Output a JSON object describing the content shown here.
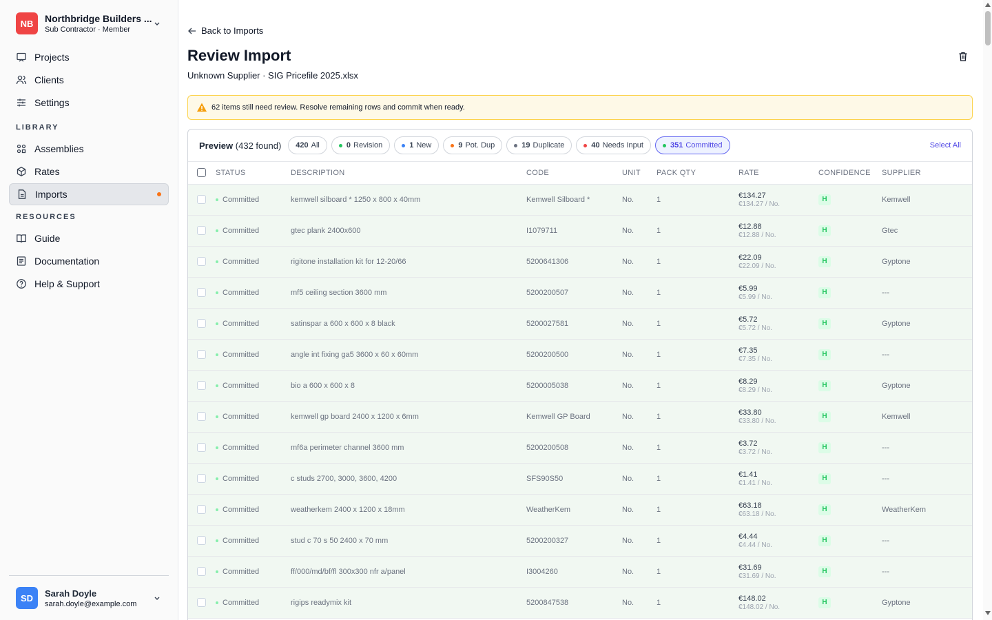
{
  "org": {
    "initials": "NB",
    "name": "Northbridge Builders ...",
    "role": "Sub Contractor · Member"
  },
  "nav": {
    "projects": "Projects",
    "clients": "Clients",
    "settings": "Settings",
    "library_heading": "LIBRARY",
    "assemblies": "Assemblies",
    "rates": "Rates",
    "imports": "Imports",
    "resources_heading": "RESOURCES",
    "guide": "Guide",
    "documentation": "Documentation",
    "help": "Help & Support"
  },
  "user": {
    "initials": "SD",
    "name": "Sarah Doyle",
    "email": "sarah.doyle@example.com"
  },
  "page": {
    "back": "Back to Imports",
    "title": "Review Import",
    "subtitle": "Unknown Supplier · SIG Pricefile 2025.xlsx",
    "alert": "62 items still need review. Resolve remaining rows and commit when ready."
  },
  "toolbar": {
    "preview_label": "Preview",
    "preview_count": "(432 found)",
    "select_all": "Select All",
    "chips": [
      {
        "count": "420",
        "label": "All",
        "color": ""
      },
      {
        "count": "0",
        "label": "Revision",
        "color": "#22c55e"
      },
      {
        "count": "1",
        "label": "New",
        "color": "#3b82f6"
      },
      {
        "count": "9",
        "label": "Pot. Dup",
        "color": "#f97316"
      },
      {
        "count": "19",
        "label": "Duplicate",
        "color": "#6b7280"
      },
      {
        "count": "40",
        "label": "Needs Input",
        "color": "#ef4444"
      },
      {
        "count": "351",
        "label": "Committed",
        "color": "#22c55e"
      }
    ]
  },
  "table": {
    "headers": [
      "STATUS",
      "DESCRIPTION",
      "CODE",
      "UNIT",
      "PACK QTY",
      "RATE",
      "CONFIDENCE",
      "SUPPLIER"
    ],
    "rows": [
      {
        "status": "Committed",
        "description": "kemwell silboard * 1250 x 800 x 40mm",
        "code": "Kemwell Silboard *",
        "unit": "No.",
        "pack": "1",
        "rate": "€134.27",
        "rate_unit": "€134.27 / No.",
        "conf": "H",
        "supplier": "Kemwell"
      },
      {
        "status": "Committed",
        "description": "gtec plank 2400x600",
        "code": "I1079711",
        "unit": "No.",
        "pack": "1",
        "rate": "€12.88",
        "rate_unit": "€12.88 / No.",
        "conf": "H",
        "supplier": "Gtec"
      },
      {
        "status": "Committed",
        "description": "rigitone installation kit for 12-20/66",
        "code": "5200641306",
        "unit": "No.",
        "pack": "1",
        "rate": "€22.09",
        "rate_unit": "€22.09 / No.",
        "conf": "H",
        "supplier": "Gyptone"
      },
      {
        "status": "Committed",
        "description": "mf5 ceiling section 3600 mm",
        "code": "5200200507",
        "unit": "No.",
        "pack": "1",
        "rate": "€5.99",
        "rate_unit": "€5.99 / No.",
        "conf": "H",
        "supplier": "---"
      },
      {
        "status": "Committed",
        "description": "satinspar a 600 x 600 x 8 black",
        "code": "5200027581",
        "unit": "No.",
        "pack": "1",
        "rate": "€5.72",
        "rate_unit": "€5.72 / No.",
        "conf": "H",
        "supplier": "Gyptone"
      },
      {
        "status": "Committed",
        "description": "angle int fixing ga5 3600 x 60 x 60mm",
        "code": "5200200500",
        "unit": "No.",
        "pack": "1",
        "rate": "€7.35",
        "rate_unit": "€7.35 / No.",
        "conf": "H",
        "supplier": "---"
      },
      {
        "status": "Committed",
        "description": "bio a 600 x 600 x 8",
        "code": "5200005038",
        "unit": "No.",
        "pack": "1",
        "rate": "€8.29",
        "rate_unit": "€8.29 / No.",
        "conf": "H",
        "supplier": "Gyptone"
      },
      {
        "status": "Committed",
        "description": "kemwell gp board 2400 x 1200 x 6mm",
        "code": "Kemwell GP Board",
        "unit": "No.",
        "pack": "1",
        "rate": "€33.80",
        "rate_unit": "€33.80 / No.",
        "conf": "H",
        "supplier": "Kemwell"
      },
      {
        "status": "Committed",
        "description": "mf6a perimeter channel 3600 mm",
        "code": "5200200508",
        "unit": "No.",
        "pack": "1",
        "rate": "€3.72",
        "rate_unit": "€3.72 / No.",
        "conf": "H",
        "supplier": "---"
      },
      {
        "status": "Committed",
        "description": "c studs 2700, 3000, 3600, 4200",
        "code": "SFS90S50",
        "unit": "No.",
        "pack": "1",
        "rate": "€1.41",
        "rate_unit": "€1.41 / No.",
        "conf": "H",
        "supplier": "---"
      },
      {
        "status": "Committed",
        "description": "weatherkem 2400 x 1200 x 18mm",
        "code": "WeatherKem",
        "unit": "No.",
        "pack": "1",
        "rate": "€63.18",
        "rate_unit": "€63.18 / No.",
        "conf": "H",
        "supplier": "WeatherKem"
      },
      {
        "status": "Committed",
        "description": "stud c 70 s 50 2400 x 70 mm",
        "code": "5200200327",
        "unit": "No.",
        "pack": "1",
        "rate": "€4.44",
        "rate_unit": "€4.44 / No.",
        "conf": "H",
        "supplier": "---"
      },
      {
        "status": "Committed",
        "description": "ff/000/md/bf/fl 300x300 nfr a/panel",
        "code": "I3004260",
        "unit": "No.",
        "pack": "1",
        "rate": "€31.69",
        "rate_unit": "€31.69 / No.",
        "conf": "H",
        "supplier": "---"
      },
      {
        "status": "Committed",
        "description": "rigips readymix kit",
        "code": "5200847538",
        "unit": "No.",
        "pack": "1",
        "rate": "€148.02",
        "rate_unit": "€148.02 / No.",
        "conf": "H",
        "supplier": "Gyptone"
      }
    ]
  }
}
